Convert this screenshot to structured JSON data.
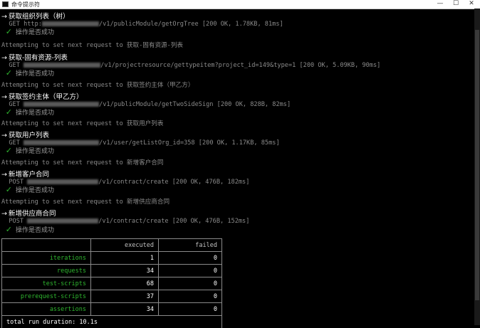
{
  "window": {
    "title": "命令提示符",
    "minimize": "—",
    "maximize": "☐",
    "close": "✕"
  },
  "sections": [
    {
      "header": "获取组织列表（树）",
      "method": "GET",
      "url_prefix": "http:",
      "url": "/v1/publicModule/getOrgTree",
      "status": "[200 OK, 1.78KB, 81ms]",
      "check": "操作是否成功",
      "next": "Attempting to set next request to 获取-固有资源-列表"
    },
    {
      "header": "获取-固有资源-列表",
      "method": "GET",
      "url_prefix": "",
      "url": "/v1/projectresource/gettypeitem?project_id=149&type=1",
      "status": "[200 OK, 5.09KB, 90ms]",
      "check": "操作是否成功",
      "next": "Attempting to set next request to 获取签约主体（甲乙方）"
    },
    {
      "header": "获取签约主体（甲乙方）",
      "method": "GET",
      "url_prefix": "",
      "url": "/v1/publicModule/getTwoSideSign",
      "status": "[200 OK, 828B, 82ms]",
      "check": "操作是否成功",
      "next": "Attempting to set next request to 获取用户列表"
    },
    {
      "header": "获取用户列表",
      "method": "GET",
      "url_prefix": "",
      "url": "/v1/user/getListOrg_id=358",
      "status": "[200 OK, 1.17KB, 85ms]",
      "check": "操作是否成功",
      "next": "Attempting to set next request to 新增客户合同"
    },
    {
      "header": "新增客户合同",
      "method": "POST",
      "url_prefix": "",
      "url": "/v1/contract/create",
      "status": " [200 OK, 476B, 182ms]",
      "check": "操作是否成功",
      "next": "Attempting to set next request to 新增供应商合同"
    },
    {
      "header": "新增供应商合同",
      "method": "POST",
      "url_prefix": "",
      "url": "/v1/contract/create",
      "status": " [200 OK, 476B, 152ms]",
      "check": "操作是否成功",
      "next": ""
    }
  ],
  "summary": {
    "columns": [
      "",
      "executed",
      "failed"
    ],
    "rows": [
      {
        "name": "iterations",
        "executed": "1",
        "failed": "0"
      },
      {
        "name": "requests",
        "executed": "34",
        "failed": "0"
      },
      {
        "name": "test-scripts",
        "executed": "68",
        "failed": "0"
      },
      {
        "name": "prerequest-scripts",
        "executed": "37",
        "failed": "0"
      },
      {
        "name": "assertions",
        "executed": "34",
        "failed": "0"
      }
    ],
    "duration": "total run duration: 10.1s"
  },
  "colors": {
    "background": "#000000",
    "pass": "#2fb52f",
    "text": "#c0c0c0"
  },
  "icons": {
    "arrow": "→",
    "check": "✓"
  }
}
